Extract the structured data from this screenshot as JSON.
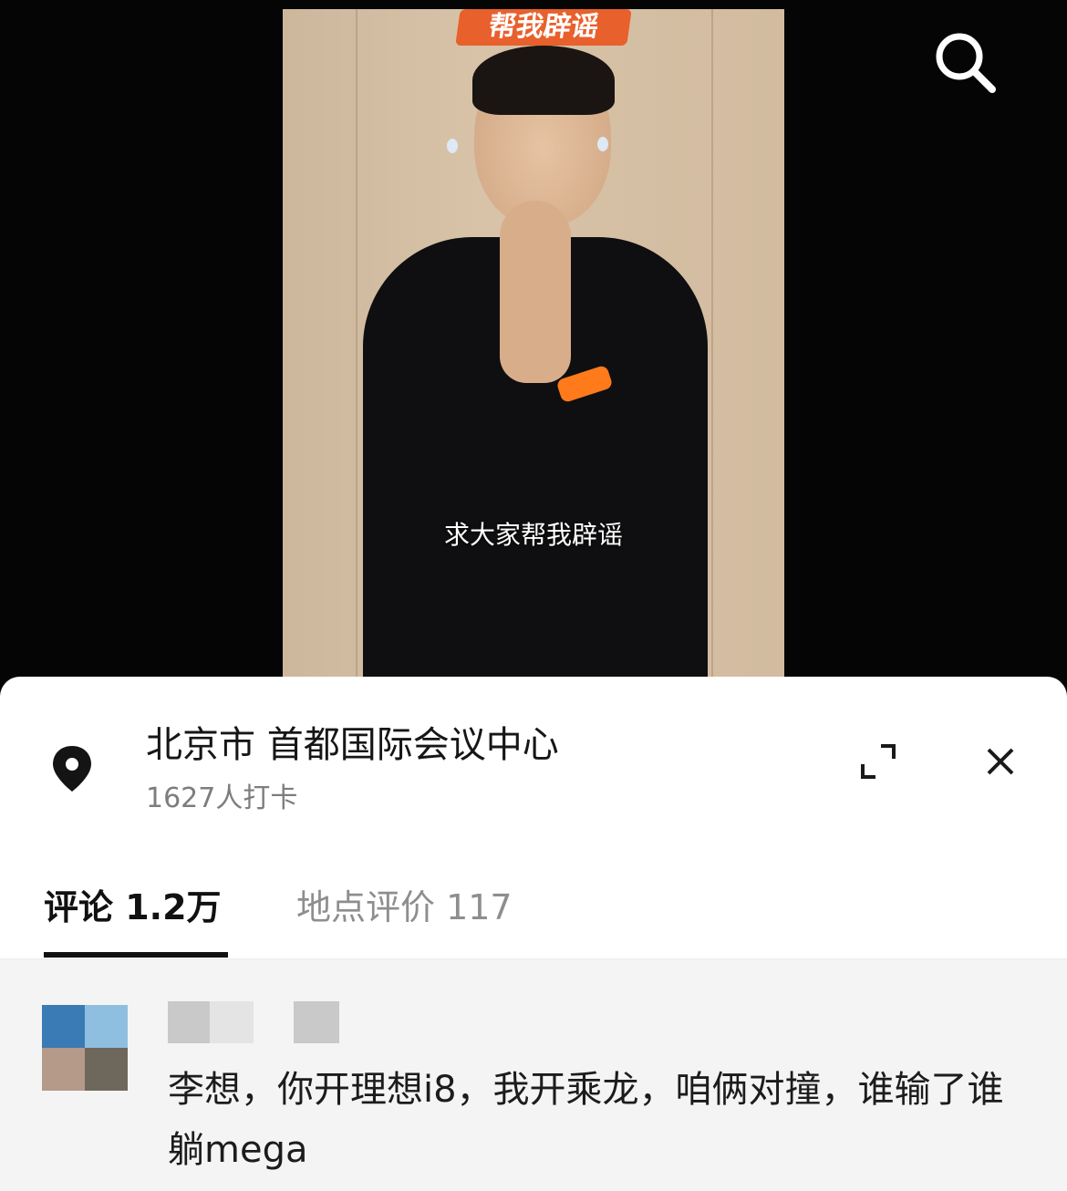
{
  "video": {
    "banner_text": "帮我辟谣",
    "subtitle": "求大家帮我辟谣"
  },
  "location_sheet": {
    "place": "北京市  首都国际会议中心",
    "checkins": "1627人打卡"
  },
  "tabs": [
    {
      "label": "评论 1.2万",
      "active": true
    },
    {
      "label": "地点评价 117",
      "active": false
    }
  ],
  "comment": {
    "text": "李想，你开理想i8，我开乘龙，咱俩对撞，谁输了谁躺mega"
  },
  "icons": {
    "search": "search-icon",
    "location": "location-pin-icon",
    "expand": "expand-icon",
    "close": "close-icon"
  },
  "colors": {
    "banner": "#e8602c",
    "watch_band": "#ff7a1a",
    "tab_active": "#111111",
    "tab_inactive": "#8e8e8e"
  }
}
